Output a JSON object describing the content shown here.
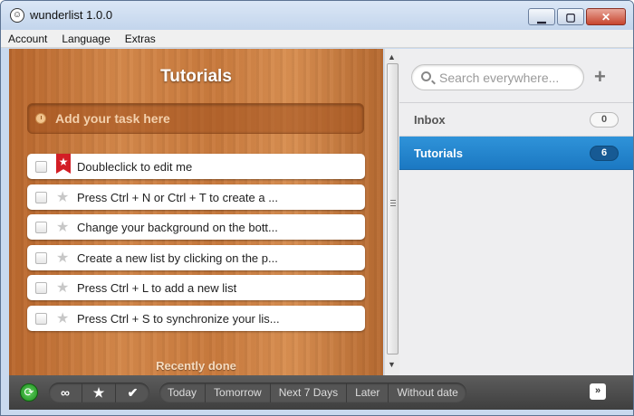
{
  "window": {
    "title": "wunderlist 1.0.0",
    "icon": "wunderlist-app-icon",
    "controls": {
      "minimize": "▁",
      "maximize": "▢",
      "close": "✕"
    }
  },
  "menu": {
    "items": [
      "Account",
      "Language",
      "Extras"
    ]
  },
  "main": {
    "list_title": "Tutorials",
    "add_task_placeholder": "Add your task here",
    "tasks": [
      {
        "text": "Doubleclick to edit me",
        "starred": true
      },
      {
        "text": "Press Ctrl + N or Ctrl + T to create a ...",
        "starred": false
      },
      {
        "text": "Change your background on the bott...",
        "starred": false
      },
      {
        "text": "Create a new list by clicking on the p...",
        "starred": false
      },
      {
        "text": "Press Ctrl + L to add a new list",
        "starred": false
      },
      {
        "text": "Press Ctrl + S to synchronize your lis...",
        "starred": false
      }
    ],
    "recently_done_label": "Recently done"
  },
  "sidebar": {
    "search_placeholder": "Search everywhere...",
    "add_list_icon": "plus-icon",
    "lists": [
      {
        "name": "Inbox",
        "count": "0",
        "active": false
      },
      {
        "name": "Tutorials",
        "count": "6",
        "active": true
      }
    ]
  },
  "bottombar": {
    "icons": [
      "sync-icon",
      "infinity-icon",
      "star-icon",
      "check-icon"
    ],
    "icon_glyphs": {
      "sync": "⟳",
      "all": "∞",
      "starred": "★",
      "done": "✔"
    },
    "filters": [
      "Today",
      "Tomorrow",
      "Next 7 Days",
      "Later",
      "Without date"
    ],
    "expand_glyph": "»"
  },
  "colors": {
    "accent": "#2184cc",
    "wood": "#c97a3d",
    "bottombar": "#4a4a4a"
  }
}
